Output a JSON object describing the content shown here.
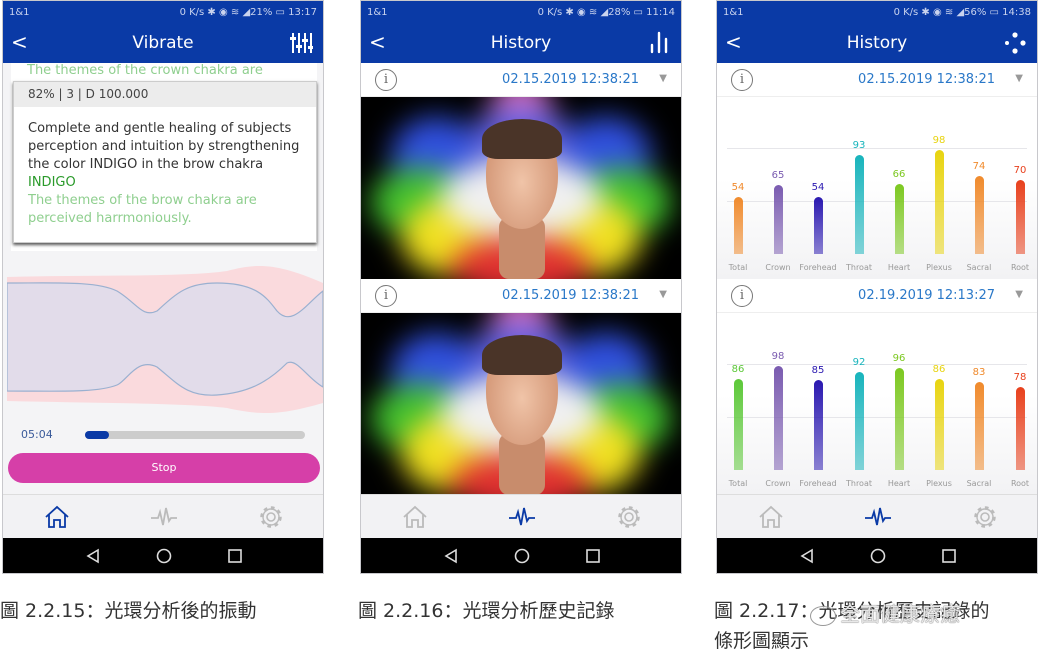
{
  "phones": [
    {
      "status": {
        "carrier": "1&1",
        "right": "0 K/s ✱ ◉ ≋ ◢21% ▭ 13:17"
      },
      "title": "Vibrate",
      "action_icon": "equalizer-sliders-icon",
      "crown_text": "The themes of the crown chakra are",
      "card": {
        "meta": "82% | 3 | D 100.000",
        "body": "Complete and gentle healing of subjects perception and intuition by strengthening the color INDIGO in the brow chakra",
        "color_name": "INDIGO",
        "note": "The themes of the brow chakra are perceived harrmoniously."
      },
      "timer": "05:04",
      "progress_percent": 11,
      "stop_label": "Stop",
      "active_nav": "home"
    },
    {
      "status": {
        "carrier": "1&1",
        "right": "0 K/s ✱ ◉ ≋ ◢28% ▭ 11:14"
      },
      "title": "History",
      "action_icon": "bar-chart-icon",
      "entries": [
        {
          "date": "02.15.2019 12:38:21"
        },
        {
          "date": "02.15.2019 12:38:21"
        }
      ],
      "active_nav": "pulse"
    },
    {
      "status": {
        "carrier": "1&1",
        "right": "0 K/s ✱ ◉ ≋ ◢56% ▭ 14:38"
      },
      "title": "History",
      "action_icon": "aura-dots-icon",
      "entries": [
        {
          "date": "02.15.2019 12:38:21"
        },
        {
          "date": "02.19.2019 12:13:27"
        }
      ],
      "active_nav": "pulse"
    }
  ],
  "chart_data": [
    {
      "type": "bar",
      "date": "02.15.2019 12:38:21",
      "ylim": [
        0,
        100
      ],
      "categories": [
        "Total",
        "Crown",
        "Forehead",
        "Throat",
        "Heart",
        "Plexus",
        "Sacral",
        "Root"
      ],
      "values": [
        54,
        65,
        54,
        93,
        66,
        98,
        74,
        70
      ],
      "colors": [
        "#f08a2c",
        "#7a5bb0",
        "#2a18b0",
        "#18b4bc",
        "#7cc820",
        "#e8d410",
        "#f08a2c",
        "#e8401c"
      ]
    },
    {
      "type": "bar",
      "date": "02.19.2019 12:13:27",
      "ylim": [
        0,
        100
      ],
      "categories": [
        "Total",
        "Crown",
        "Forehead",
        "Throat",
        "Heart",
        "Plexus",
        "Sacral",
        "Root"
      ],
      "values": [
        86,
        98,
        85,
        92,
        96,
        86,
        83,
        78
      ],
      "colors": [
        "#5cc838",
        "#7a5bb0",
        "#2a18b0",
        "#18b4bc",
        "#7cc820",
        "#e8d410",
        "#f08a2c",
        "#e8401c"
      ]
    }
  ],
  "captions": [
    "圖 2.2.15：光環分析後的振動",
    "圖 2.2.16：光環分析歷史記錄",
    "圖 2.2.17：光環分析歷史記錄的",
    "條形圖顯示"
  ],
  "watermark": "全面健康療癒",
  "colors": {
    "header": "#0a3aa6",
    "stop_button": "#d63fa8",
    "accent_green": "#2a9a2a",
    "date_blue": "#2a78c8"
  }
}
